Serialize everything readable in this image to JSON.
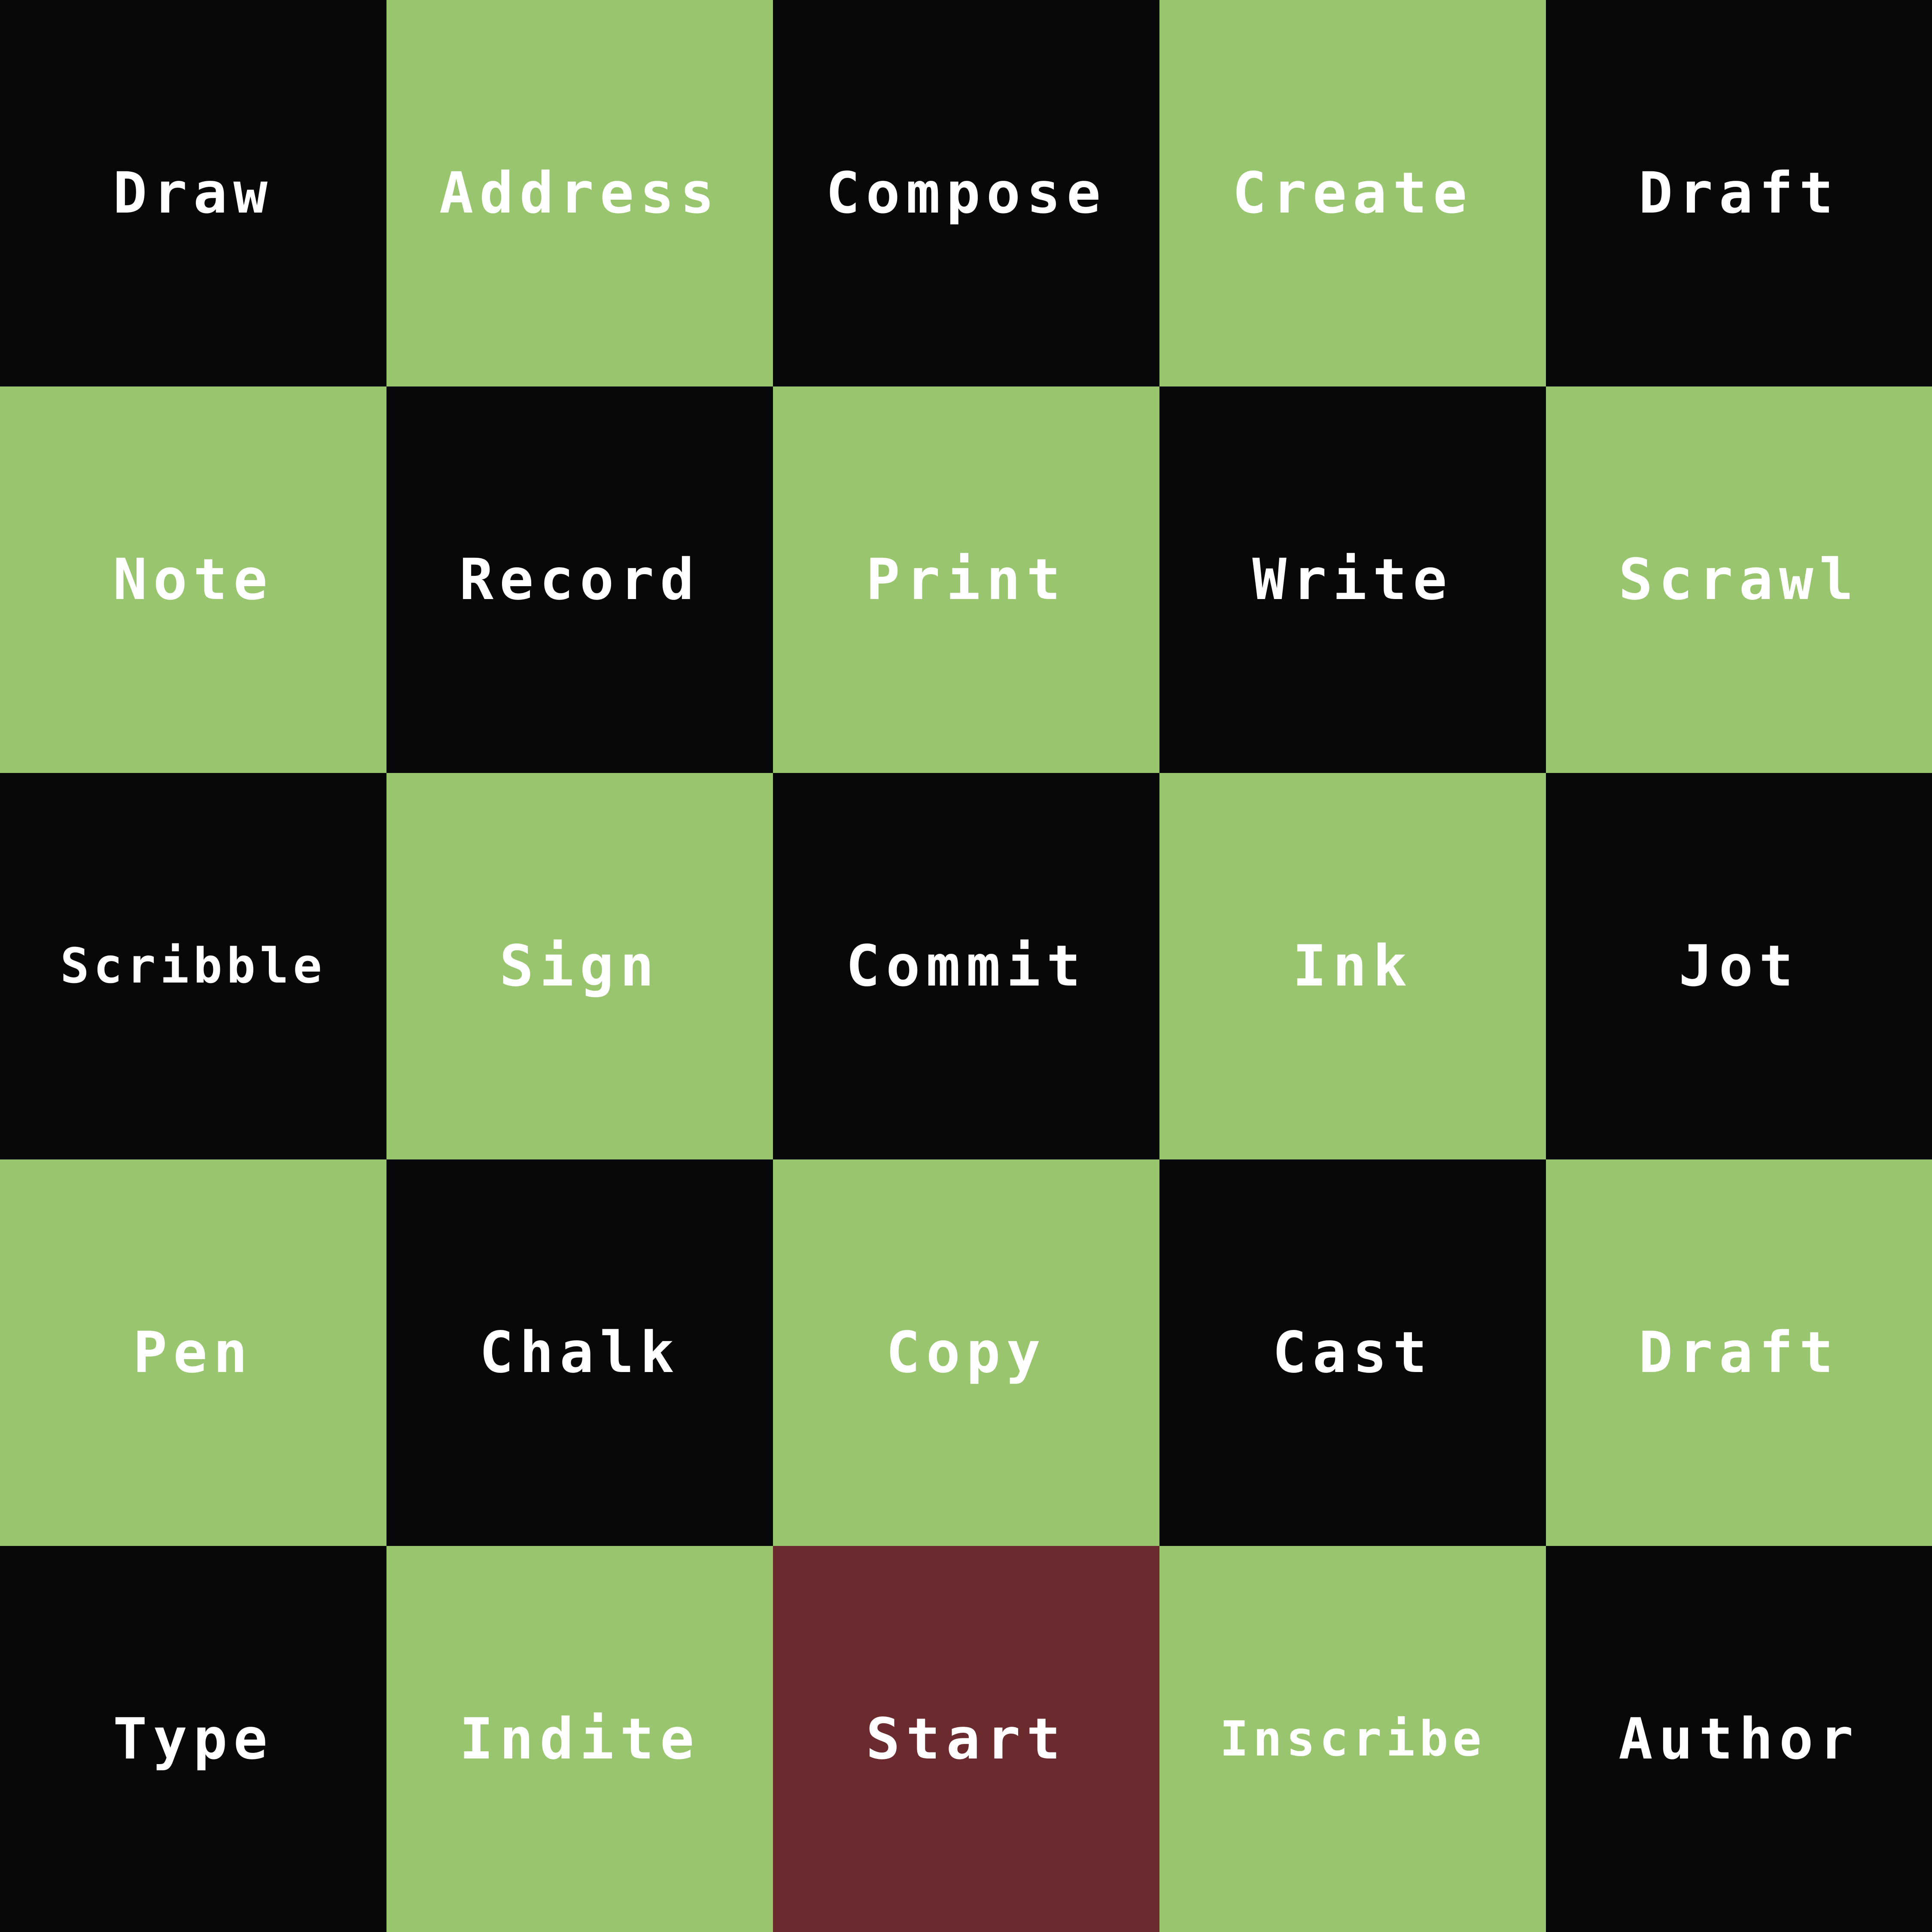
{
  "colors": {
    "dark": "#06080a",
    "green": "#98c56d",
    "start": "#6b2a2d",
    "text": "#ffffff"
  },
  "board": {
    "rows": [
      [
        {
          "label": "Draw",
          "color": "dark"
        },
        {
          "label": "Address",
          "color": "green"
        },
        {
          "label": "Compose",
          "color": "dark"
        },
        {
          "label": "Create",
          "color": "green"
        },
        {
          "label": "Draft",
          "color": "dark"
        }
      ],
      [
        {
          "label": "Note",
          "color": "green"
        },
        {
          "label": "Record",
          "color": "dark"
        },
        {
          "label": "Print",
          "color": "green"
        },
        {
          "label": "Write",
          "color": "dark"
        },
        {
          "label": "Scrawl",
          "color": "green"
        }
      ],
      [
        {
          "label": "Scribble",
          "color": "dark"
        },
        {
          "label": "Sign",
          "color": "green"
        },
        {
          "label": "Commit",
          "color": "dark"
        },
        {
          "label": "Ink",
          "color": "green"
        },
        {
          "label": "Jot",
          "color": "dark"
        }
      ],
      [
        {
          "label": "Pen",
          "color": "green"
        },
        {
          "label": "Chalk",
          "color": "dark"
        },
        {
          "label": "Copy",
          "color": "green"
        },
        {
          "label": "Cast",
          "color": "dark"
        },
        {
          "label": "Draft",
          "color": "green"
        }
      ],
      [
        {
          "label": "Type",
          "color": "dark"
        },
        {
          "label": "Indite",
          "color": "green"
        },
        {
          "label": "Start",
          "color": "start"
        },
        {
          "label": "Inscribe",
          "color": "green"
        },
        {
          "label": "Author",
          "color": "dark"
        }
      ]
    ]
  }
}
